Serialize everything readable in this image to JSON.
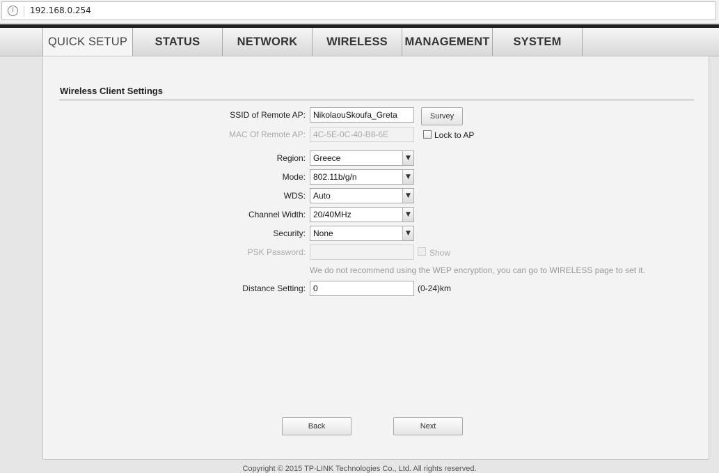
{
  "browser": {
    "url": "192.168.0.254",
    "site_icon": "info-circle-icon"
  },
  "nav": {
    "tabs": [
      "QUICK SETUP",
      "STATUS",
      "NETWORK",
      "WIRELESS",
      "MANAGEMENT",
      "SYSTEM"
    ],
    "active": "QUICK SETUP"
  },
  "page": {
    "title": "Wireless Client Settings"
  },
  "form": {
    "ssid_label": "SSID of Remote AP:",
    "ssid_value": "NikolaouSkoufa_Greta",
    "survey_button": "Survey",
    "mac_label": "MAC Of Remote AP:",
    "mac_value": "4C-5E-0C-40-B8-6E",
    "lock_to_ap_label": "Lock to AP",
    "lock_to_ap_checked": false,
    "region_label": "Region:",
    "region_value": "Greece",
    "mode_label": "Mode:",
    "mode_value": "802.11b/g/n",
    "wds_label": "WDS:",
    "wds_value": "Auto",
    "channel_width_label": "Channel Width:",
    "channel_width_value": "20/40MHz",
    "security_label": "Security:",
    "security_value": "None",
    "psk_label": "PSK Password:",
    "psk_value": "",
    "show_label": "Show",
    "wep_note": "We do not recommend using the WEP encryption, you can go to WIRELESS page to set it.",
    "distance_label": "Distance Setting:",
    "distance_value": "0",
    "distance_unit": "(0-24)km"
  },
  "buttons": {
    "back": "Back",
    "next": "Next"
  },
  "footer": {
    "text": "Copyright © 2015 TP-LINK Technologies Co., Ltd. All rights reserved."
  },
  "colors": {
    "nav_background": "#e0e0e0",
    "panel_background": "#f3f3f3",
    "disabled_text": "#aaaaaa",
    "note_text": "#999999"
  }
}
